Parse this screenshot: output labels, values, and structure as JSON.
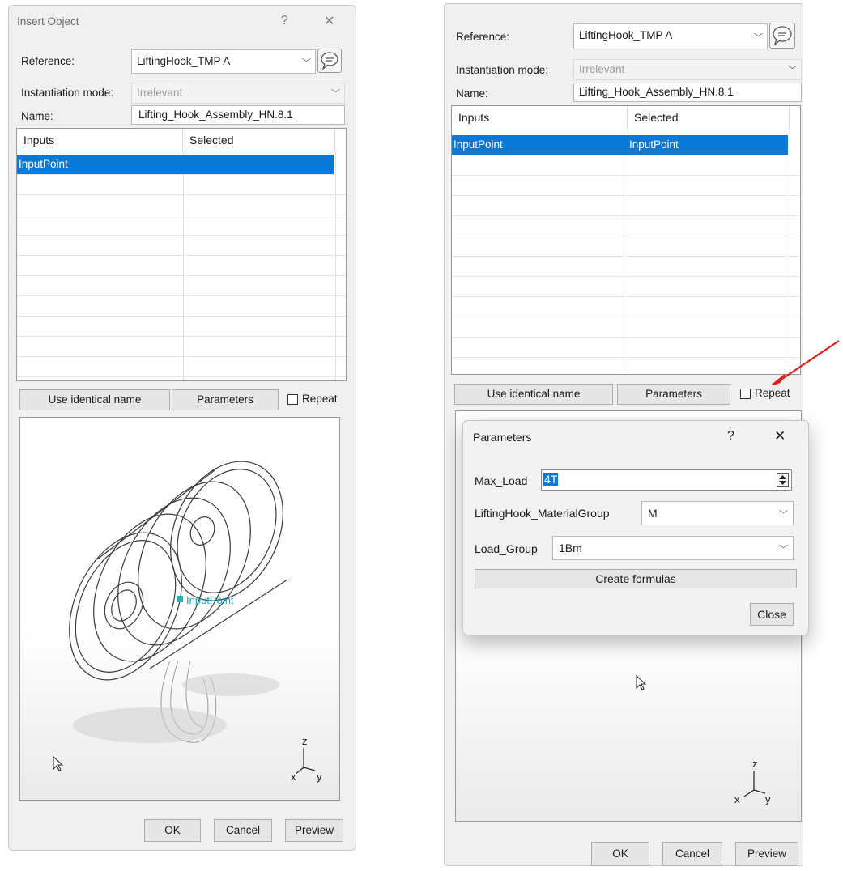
{
  "left_dialog": {
    "title": "Insert Object",
    "help": "?",
    "close": "✕",
    "reference_label": "Reference:",
    "reference_value": "LiftingHook_TMP A",
    "instantiation_label": "Instantiation mode:",
    "instantiation_value": "Irrelevant",
    "name_label": "Name:",
    "name_value": "Lifting_Hook_Assembly_HN.8.1",
    "table": {
      "headers": [
        "Inputs",
        "Selected"
      ],
      "rows": [
        [
          "InputPoint",
          ""
        ]
      ]
    },
    "use_identical_name": "Use identical name",
    "parameters": "Parameters",
    "repeat": "Repeat",
    "viewport_label": "InputPoint",
    "axes": {
      "z": "z",
      "x": "x",
      "y": "y"
    },
    "ok": "OK",
    "cancel": "Cancel",
    "preview": "Preview"
  },
  "right_dialog": {
    "reference_label": "Reference:",
    "reference_value": "LiftingHook_TMP A",
    "instantiation_label": "Instantiation mode:",
    "instantiation_value": "Irrelevant",
    "name_label": "Name:",
    "name_value": "Lifting_Hook_Assembly_HN.8.1",
    "table": {
      "headers": [
        "Inputs",
        "Selected"
      ],
      "rows": [
        [
          "InputPoint",
          "InputPoint"
        ]
      ]
    },
    "use_identical_name": "Use identical name",
    "parameters": "Parameters",
    "repeat": "Repeat",
    "axes": {
      "z": "z",
      "x": "x",
      "y": "y"
    },
    "ok": "OK",
    "cancel": "Cancel",
    "preview": "Preview"
  },
  "parameters_dialog": {
    "title": "Parameters",
    "help": "?",
    "close": "✕",
    "max_load_label": "Max_Load",
    "max_load_value": "4T",
    "material_group_label": "LiftingHook_MaterialGroup",
    "material_group_value": "M",
    "load_group_label": "Load_Group",
    "load_group_value": "1Bm",
    "create_formulas": "Create formulas",
    "close_button": "Close"
  },
  "colors": {
    "selection": "#0a78d7",
    "annotation_arrow": "#e0201c"
  }
}
